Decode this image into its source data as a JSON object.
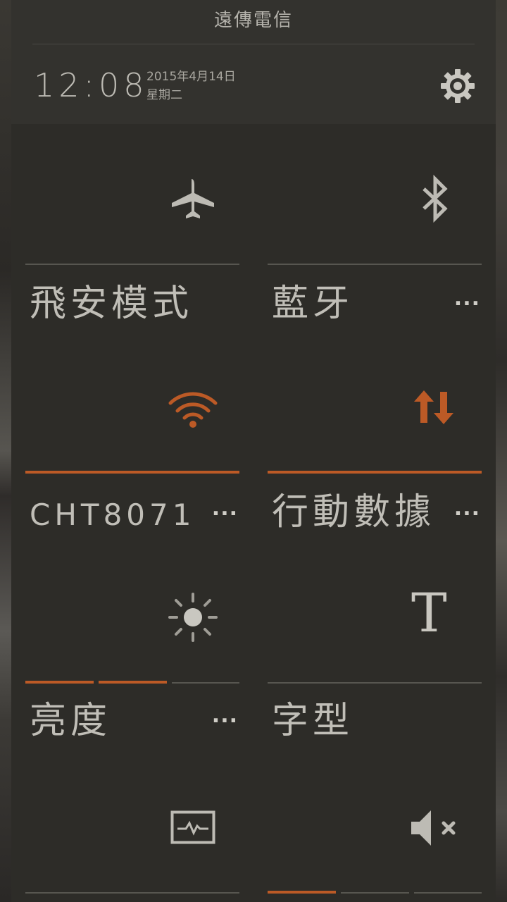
{
  "status": {
    "carrier": "遠傳電信",
    "time": "12:08",
    "date": "2015年4月14日",
    "weekday": "星期二"
  },
  "tiles": [
    {
      "id": "airplane",
      "label": "飛安模式",
      "icon": "airplane-icon",
      "active": false,
      "has_more": false
    },
    {
      "id": "bluetooth",
      "label": "藍牙",
      "icon": "bluetooth-icon",
      "active": false,
      "has_more": true,
      "more": "..."
    },
    {
      "id": "wifi",
      "label": "CHT8071",
      "icon": "wifi-icon",
      "active": true,
      "has_more": true,
      "more": "..."
    },
    {
      "id": "mobile-data",
      "label": "行動數據",
      "icon": "data-arrows-icon",
      "active": true,
      "has_more": true,
      "more": "..."
    },
    {
      "id": "brightness",
      "label": "亮度",
      "icon": "brightness-icon",
      "level": "2 of 3",
      "has_more": true,
      "more": "..."
    },
    {
      "id": "font",
      "label": "字型",
      "icon": "font-icon",
      "glyph": "T",
      "active": false,
      "has_more": false
    },
    {
      "id": "power-saving",
      "label": "",
      "icon": "pulse-icon",
      "active": false
    },
    {
      "id": "sound",
      "label": "",
      "icon": "mute-icon",
      "level": "1 of 3"
    }
  ],
  "colors": {
    "accent": "#bc5a26",
    "panel": "#2d2c28",
    "text": "#c0beb7"
  }
}
